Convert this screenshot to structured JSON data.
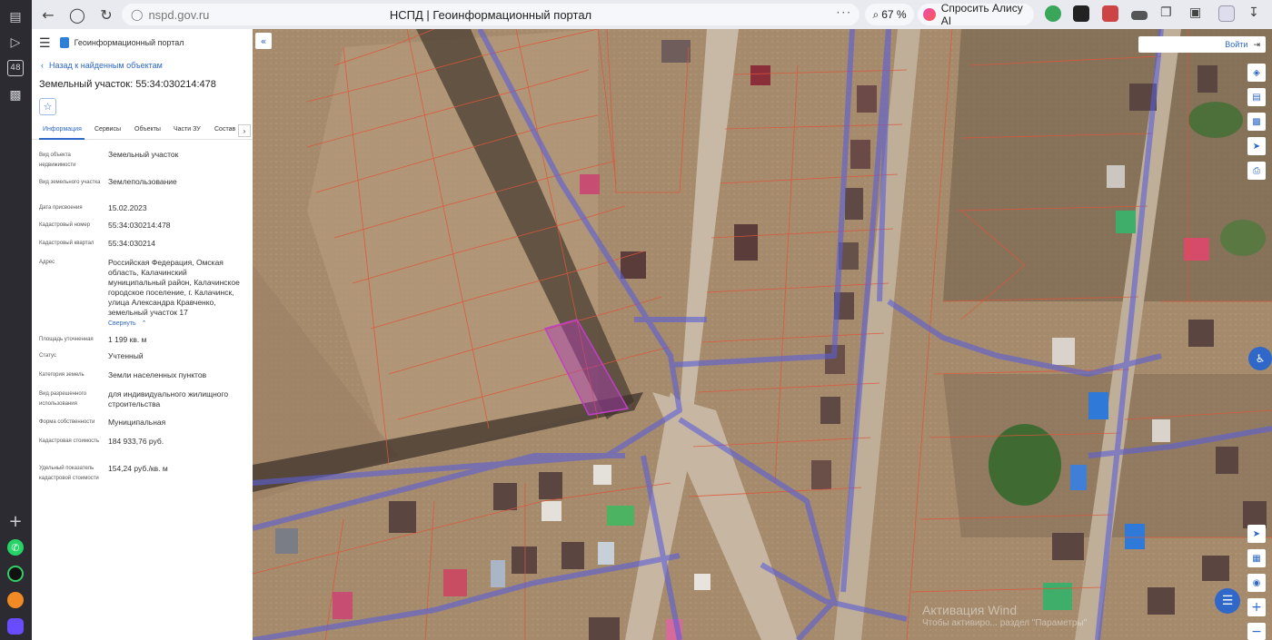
{
  "browser": {
    "url": "nspd.gov.ru",
    "title": "НСПД | Геоинформационный портал",
    "zoom": "67 %",
    "alice": "Спросить Алису AI",
    "more": "···"
  },
  "rail": {
    "badge": "48"
  },
  "panel": {
    "portal_name": "Геоинформационный портал",
    "back_link": "Назад к найденным объектам",
    "title": "Земельный участок: 55:34:030214:478",
    "tabs": [
      "Информация",
      "Сервисы",
      "Объекты",
      "Части ЗУ",
      "Состав"
    ],
    "fields": [
      {
        "label": "Вид объекта недвижимости",
        "value": "Земельный участок"
      },
      {
        "label": "Вид земельного участка",
        "value": "Землепользование"
      },
      {
        "label": "Дата присвоения",
        "value": "15.02.2023"
      },
      {
        "label": "Кадастровый номер",
        "value": "55:34:030214:478"
      },
      {
        "label": "Кадастровый квартал",
        "value": "55:34:030214"
      },
      {
        "label": "Адрес",
        "value": "Российская Федерация, Омская область, Калачинский муниципальный район, Калачинское городское поселение, г. Калачинск, улица Александра Кравченко, земельный участок 17"
      },
      {
        "label": "Площадь уточненная",
        "value": "1 199 кв. м"
      },
      {
        "label": "Статус",
        "value": "Учтенный"
      },
      {
        "label": "Категория земель",
        "value": "Земли населенных пунктов"
      },
      {
        "label": "Вид разрешенного использования",
        "value": "для индивидуального жилищного строительства"
      },
      {
        "label": "Форма собственности",
        "value": "Муниципальная"
      },
      {
        "label": "Кадастровая стоимость",
        "value": "184 933,76 руб."
      },
      {
        "label": "Удельный показатель кадастровой стоимости",
        "value": "154,24 руб./кв. м"
      }
    ],
    "collapse_label": "Свернуть"
  },
  "map": {
    "login_label": "Войти",
    "watermark_title": "Активация Wind",
    "watermark_sub": "Чтобы активиро... раздел \"Параметры\""
  },
  "colors": {
    "accent": "#2f68c9",
    "boundary": "#e0553a",
    "zone": "#5a5fd8",
    "selected_parcel": "#b03cb8"
  }
}
